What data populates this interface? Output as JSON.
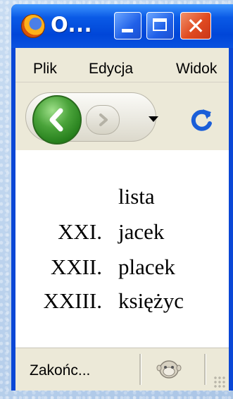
{
  "window": {
    "title": "O...",
    "controls": {
      "minimize_icon": "minimize-icon",
      "maximize_icon": "maximize-icon",
      "close_icon": "close-icon",
      "close_glyph": "✕"
    }
  },
  "menu": {
    "items": [
      "Plik",
      "Edycja",
      "Widok"
    ]
  },
  "navigation": {
    "back_icon": "back-arrow-icon",
    "forward_icon": "forward-arrow-icon",
    "dropdown_icon": "chevron-down-icon",
    "reload_icon": "reload-icon"
  },
  "content": {
    "heading": "lista",
    "items": [
      {
        "marker": "XXI.",
        "text": "jacek"
      },
      {
        "marker": "XXII.",
        "text": "placek"
      },
      {
        "marker": "XXIII.",
        "text": "księżyc"
      }
    ]
  },
  "status": {
    "text": "Zakońc...",
    "mascot_icon": "monkey-icon"
  },
  "colors": {
    "titlebar": "#0a52e0",
    "close_button": "#e04a20",
    "chrome": "#ece9d8",
    "back_button": "#4aa33a",
    "reload_icon": "#1a5ed8"
  }
}
